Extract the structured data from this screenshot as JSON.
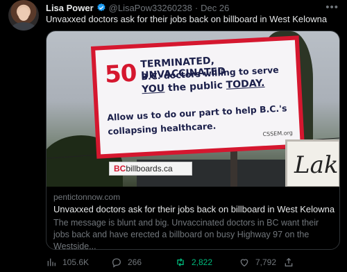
{
  "author": {
    "name": "Lisa Power",
    "handle": "@LisaPow33260238",
    "separator": "·",
    "date": "Dec 26",
    "more": "•••"
  },
  "tweet": {
    "text": "Unvaxxed doctors ask for their jobs back on billboard in West Kelowna"
  },
  "billboard": {
    "number": "50",
    "line1": "TERMINATED, UNVACCINATED",
    "line2": "B.C. doctors willing to serve",
    "line3_you": "YOU",
    "line3_mid": " the public ",
    "line3_today": "TODAY.",
    "line4": "Allow us to do our part to help B.C.'s",
    "line5": "collapsing healthcare.",
    "site": "CSSEM.org",
    "vendor_b": "BC",
    "vendor_rest": "billboards.ca",
    "lake": "Lak"
  },
  "card": {
    "domain": "pentictonnow.com",
    "title": "Unvaxxed doctors ask for their jobs back on billboard in West Kelowna",
    "description": "The message is blunt and big. Unvaccinated doctors in BC want their jobs back and have erected a billboard on busy Highway 97 on the Westside..."
  },
  "actions": {
    "views": "105.6K",
    "replies": "266",
    "retweets": "2,822",
    "likes": "7,792"
  },
  "colors": {
    "background": "#000000",
    "text": "#e7e9ea",
    "muted": "#71767b",
    "verified": "#1d9bf0",
    "retweet": "#00ba7c",
    "billboard_red": "#d5172f"
  },
  "icons": [
    "verified-badge-icon",
    "more-icon",
    "views-icon",
    "reply-icon",
    "retweet-icon",
    "like-icon",
    "share-icon"
  ]
}
